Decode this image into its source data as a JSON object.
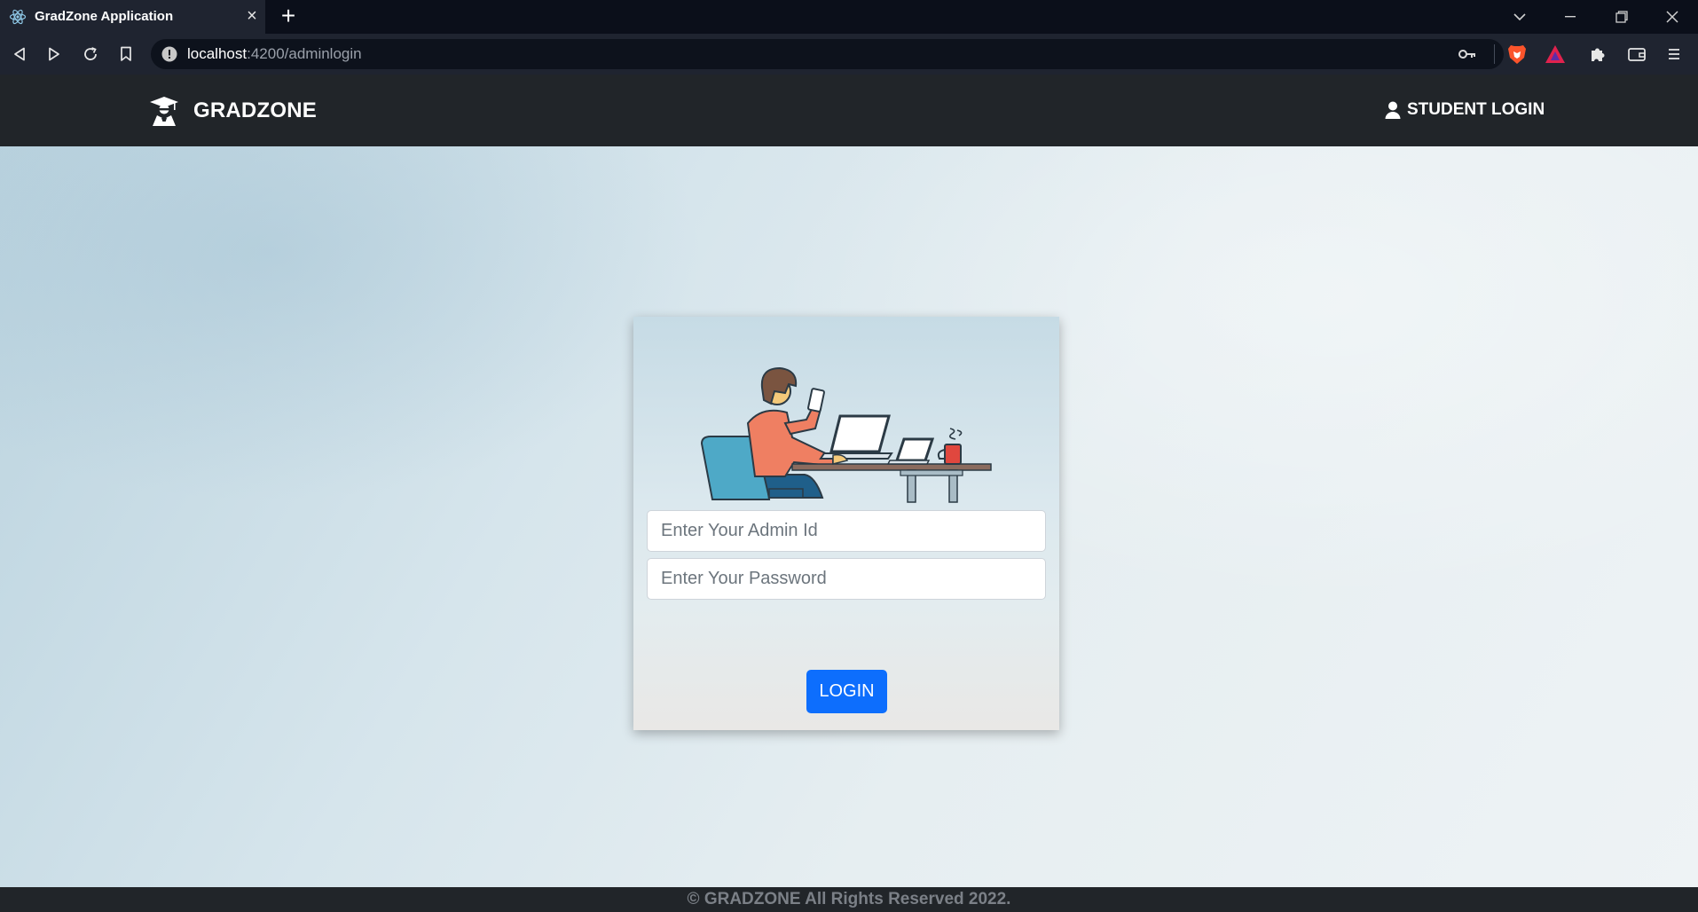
{
  "browser": {
    "tab_title": "GradZone Application",
    "tab_close": "×",
    "new_tab": "+",
    "url_host": "localhost",
    "url_path": ":4200/adminlogin"
  },
  "navbar": {
    "brand": "GRADZONE",
    "student_login": "STUDENT LOGIN"
  },
  "login_form": {
    "admin_id_placeholder": "Enter Your Admin Id",
    "password_placeholder": "Enter Your Password",
    "login_label": "LOGIN"
  },
  "footer": {
    "text": "© GRADZONE All Rights Reserved 2022."
  },
  "colors": {
    "navbar_bg": "#212529",
    "button_primary": "#0d6efd"
  }
}
